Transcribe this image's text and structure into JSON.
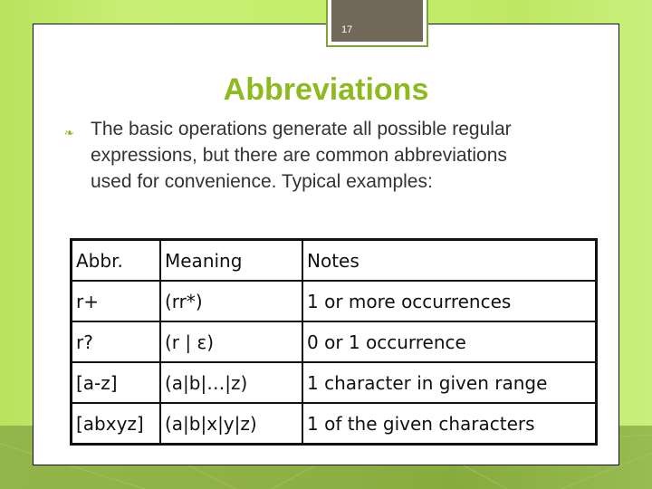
{
  "slide": {
    "page_number": "17",
    "title": "Abbreviations",
    "bullet_icon": "leaf-bullet-icon",
    "body_lines": [
      "The basic operations generate all possible regular",
      "expressions, but there are common abbreviations",
      "used for convenience. Typical examples:"
    ],
    "colors": {
      "title": "#8dbb1f",
      "background_green": "#c4ee6c",
      "page_box": "#72685a"
    }
  },
  "table": {
    "headers": [
      "Abbr.",
      "Meaning",
      "Notes"
    ],
    "rows": [
      [
        "r+",
        "(rr*)",
        "1 or more occurrences"
      ],
      [
        "r?",
        "(r | ε)",
        "0 or 1 occurrence"
      ],
      [
        "[a-z]",
        "(a|b|…|z)",
        "1 character in given range"
      ],
      [
        "[abxyz]",
        "(a|b|x|y|z)",
        "1 of the given characters"
      ]
    ]
  }
}
